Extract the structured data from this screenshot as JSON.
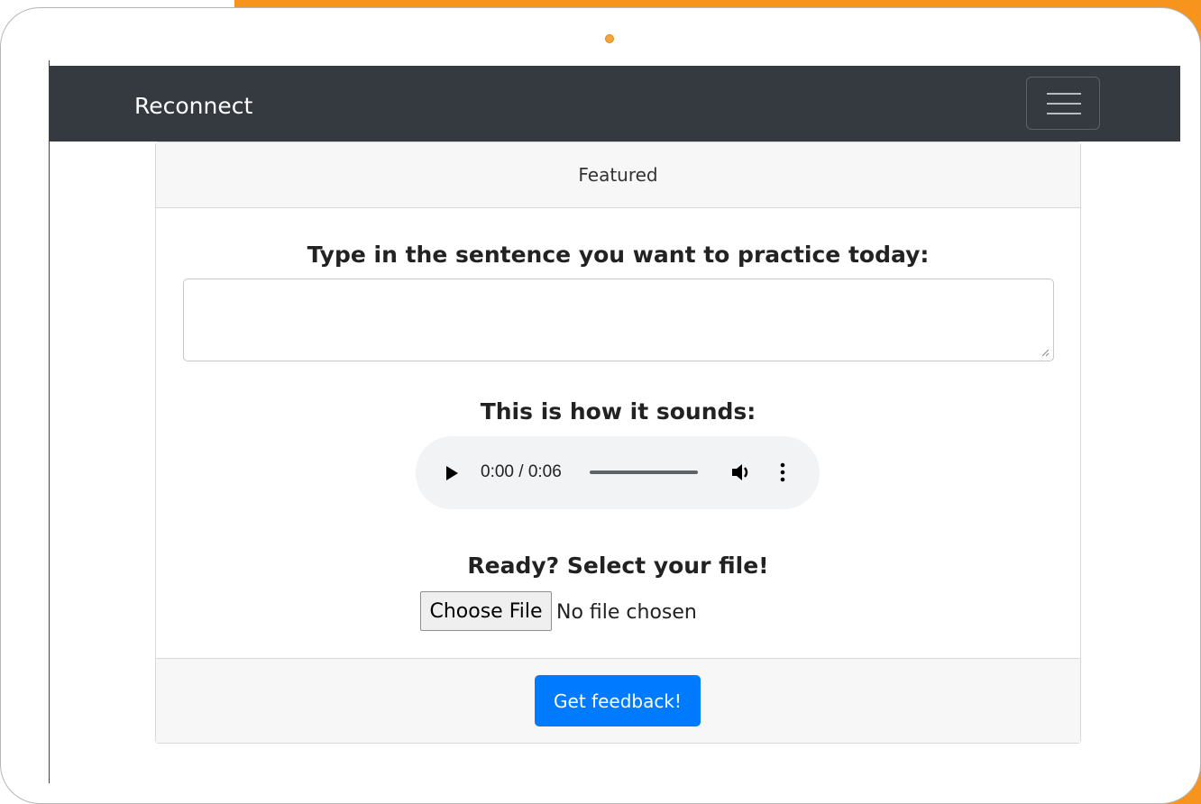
{
  "navbar": {
    "brand": "Reconnect",
    "toggler_icon": "hamburger-menu-icon"
  },
  "card": {
    "header": "Featured",
    "prompt_heading": "Type in the sentence you want to practice today:",
    "sentence_input": {
      "value": "",
      "placeholder": ""
    },
    "audio_heading": "This is how it sounds:",
    "audio_player": {
      "time_display": "0:00 / 0:06",
      "current_time": "0:00",
      "duration": "0:06",
      "progress": 0,
      "icons": [
        "play-icon",
        "volume-icon",
        "more-options-icon"
      ]
    },
    "upload_heading": "Ready? Select your file!",
    "file_input": {
      "button_label": "Choose File",
      "status": "No file chosen"
    },
    "footer_button": "Get feedback!"
  },
  "colors": {
    "navbar_bg": "#343a40",
    "primary_button": "#007bff",
    "frame_accent": "#f7941d"
  }
}
